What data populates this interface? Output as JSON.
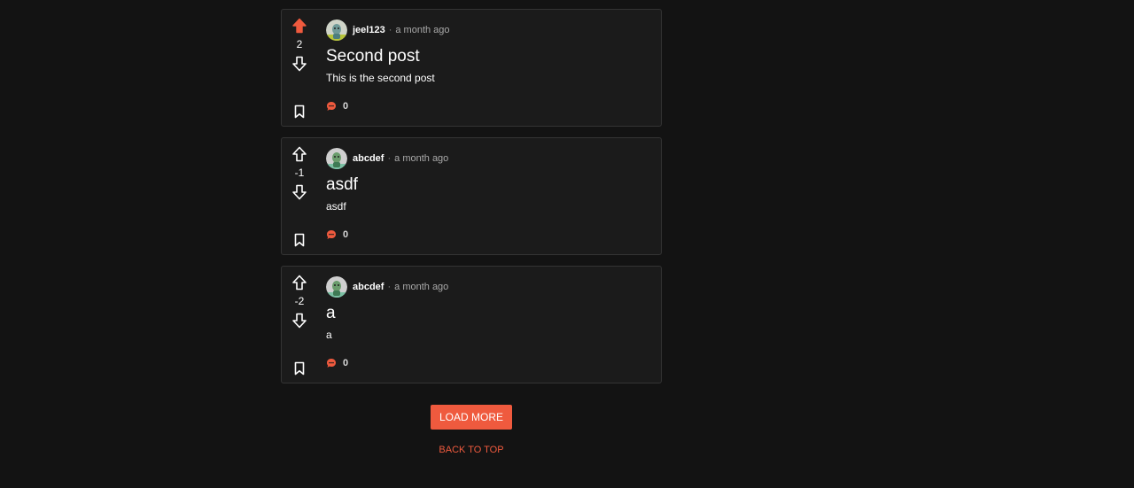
{
  "colors": {
    "accent": "#ef5a3e",
    "background": "#131313",
    "card": "#1b1b1b",
    "border": "#343434",
    "text": "#ffffff",
    "muted": "#a9a9a9"
  },
  "posts": [
    {
      "author": "jeel123",
      "separator": "·",
      "time": "a month ago",
      "title": "Second post",
      "excerpt": "This is the second post",
      "score": "2",
      "upvoted": true,
      "comment_count": "0",
      "icons": [
        "arrow-up-icon",
        "arrow-down-icon",
        "bookmark-icon",
        "comment-icon"
      ]
    },
    {
      "author": "abcdef",
      "separator": "·",
      "time": "a month ago",
      "title": "asdf",
      "excerpt": "asdf",
      "score": "-1",
      "upvoted": false,
      "comment_count": "0",
      "icons": [
        "arrow-up-icon",
        "arrow-down-icon",
        "bookmark-icon",
        "comment-icon"
      ]
    },
    {
      "author": "abcdef",
      "separator": "·",
      "time": "a month ago",
      "title": "a",
      "excerpt": "a",
      "score": "-2",
      "upvoted": false,
      "comment_count": "0",
      "icons": [
        "arrow-up-icon",
        "arrow-down-icon",
        "bookmark-icon",
        "comment-icon"
      ]
    }
  ],
  "actions": {
    "load_more_label": "LOAD MORE",
    "back_to_top_label": "BACK TO TOP"
  }
}
